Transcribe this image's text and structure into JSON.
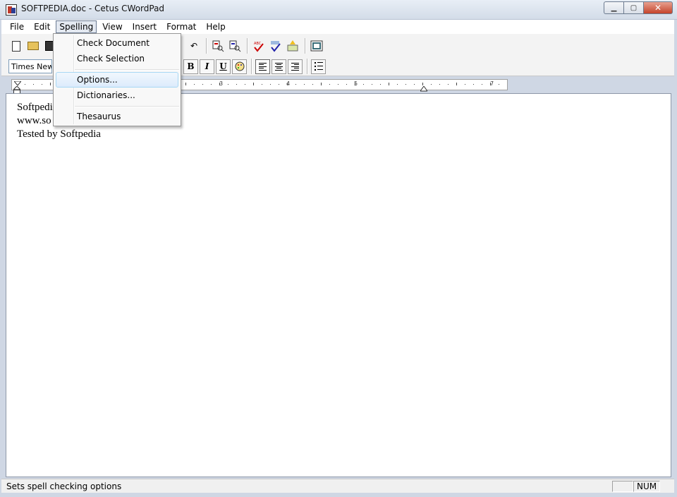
{
  "window": {
    "title": "SOFTPEDIA.doc - Cetus CWordPad"
  },
  "menubar": {
    "items": [
      "File",
      "Edit",
      "Spelling",
      "View",
      "Insert",
      "Format",
      "Help"
    ]
  },
  "spelling_menu": {
    "check_document": "Check Document",
    "check_selection": "Check Selection",
    "options": "Options...",
    "dictionaries": "Dictionaries...",
    "thesaurus": "Thesaurus"
  },
  "format_bar": {
    "font_name": "Times New",
    "bold_label": "B",
    "italic_label": "I",
    "underline_label": "U"
  },
  "ruler": {
    "labels": [
      "3",
      "4",
      "5",
      "7"
    ]
  },
  "document": {
    "lines": [
      "Softpedi",
      "www.so",
      "Tested by Softpedia"
    ]
  },
  "statusbar": {
    "message": "Sets spell checking options",
    "num_indicator": "NUM"
  },
  "colors": {
    "menu_highlight": "#dcebfc",
    "close_button": "#c4442b"
  },
  "icons": [
    "new-document-icon",
    "open-folder-icon",
    "save-disk-icon",
    "spell-check-icon",
    "font-color-icon",
    "bullets-icon"
  ]
}
